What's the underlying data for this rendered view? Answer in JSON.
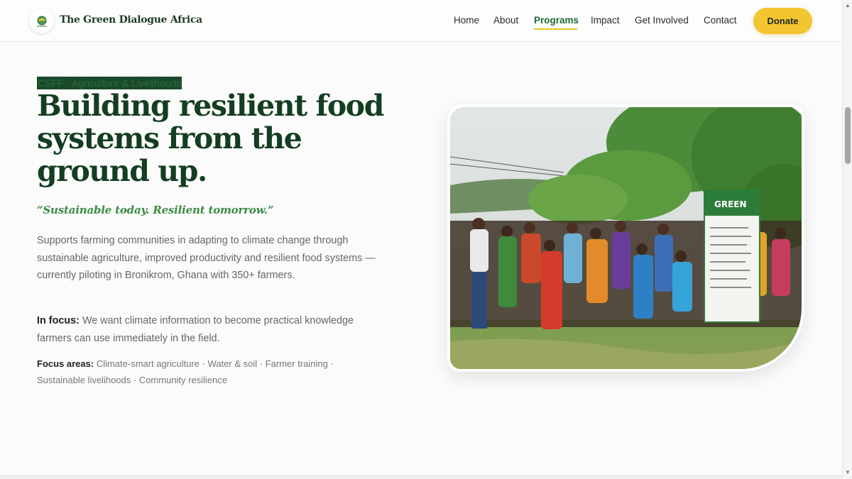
{
  "header": {
    "site_name": "The Green Dialogue Africa",
    "logo_icon": "globe-leaf-logo",
    "nav": [
      {
        "label": "Home",
        "active": false
      },
      {
        "label": "About",
        "active": false
      },
      {
        "label": "Programs",
        "active": true
      },
      {
        "label": "Impact",
        "active": false
      },
      {
        "label": "Get Involved",
        "active": false
      },
      {
        "label": "Contact",
        "active": false
      }
    ],
    "donate_label": "Donate"
  },
  "hero": {
    "eyebrow": "CSFF · Agriculture & Livelihoods",
    "headline": "Building resilient food systems from the ground up.",
    "tagline": "“Sustainable today. Resilient tomorrow.”",
    "description": "Supports farming communities in adapting to climate change through sustainable agriculture, improved productivity and resilient food systems — currently piloting in Bronikrom, Ghana with 350+ farmers.",
    "focus_label": "In focus:",
    "focus_text": " We want climate information to become practical knowledge farmers can use immediately in the field.",
    "areas_label": "Focus areas:",
    "areas_text": " Climate-smart agriculture · Water & soil · Farmer training · Sustainable livelihoods · Community resilience"
  },
  "photo": {
    "banner_text": "GREEN"
  },
  "colors": {
    "brand_green": "#143d22",
    "accent_green": "#3b8a44",
    "donate_yellow": "#f2c531"
  }
}
